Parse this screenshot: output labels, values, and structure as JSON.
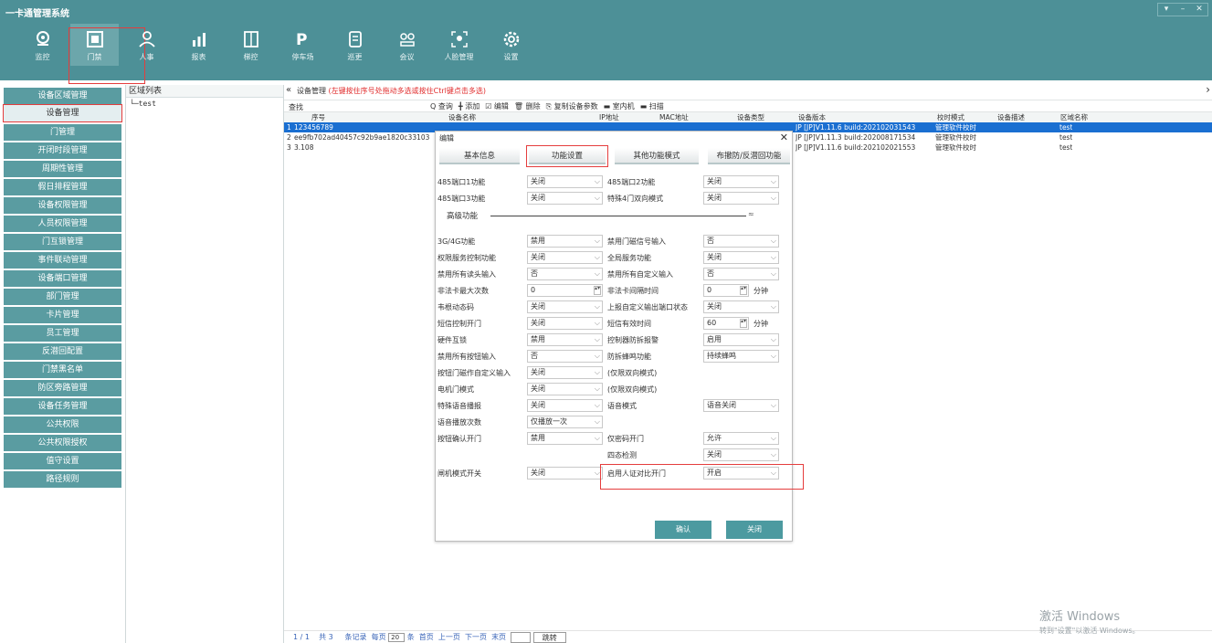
{
  "app": {
    "title": "一卡通管理系统"
  },
  "window_controls": [
    "▾",
    "–",
    "✕"
  ],
  "modules": [
    {
      "label": "监控",
      "icon": "monitor-icon"
    },
    {
      "label": "门禁",
      "icon": "door-access-icon",
      "active": true
    },
    {
      "label": "人事",
      "icon": "person-icon"
    },
    {
      "label": "报表",
      "icon": "report-icon"
    },
    {
      "label": "梯控",
      "icon": "elevator-icon"
    },
    {
      "label": "停车场",
      "icon": "parking-icon"
    },
    {
      "label": "巡更",
      "icon": "patrol-icon"
    },
    {
      "label": "会议",
      "icon": "meeting-icon"
    },
    {
      "label": "人脸管理",
      "icon": "face-icon"
    },
    {
      "label": "设置",
      "icon": "settings-icon"
    }
  ],
  "sidebar": {
    "items": [
      {
        "label": "设备区域管理"
      },
      {
        "label": "设备管理",
        "active": true
      },
      {
        "label": "门管理"
      },
      {
        "label": "开闭时段管理"
      },
      {
        "label": "周期性管理"
      },
      {
        "label": "假日排程管理"
      },
      {
        "label": "设备权限管理"
      },
      {
        "label": "人员权限管理"
      },
      {
        "label": "门互锁管理"
      },
      {
        "label": "事件联动管理"
      },
      {
        "label": "设备端口管理"
      },
      {
        "label": "部门管理"
      },
      {
        "label": "卡片管理"
      },
      {
        "label": "员工管理"
      },
      {
        "label": "反潜回配置"
      },
      {
        "label": "门禁黑名单"
      },
      {
        "label": "防区旁路管理"
      },
      {
        "label": "设备任务管理"
      },
      {
        "label": "公共权限"
      },
      {
        "label": "公共权限授权"
      },
      {
        "label": "值守设置"
      },
      {
        "label": "路径规则"
      }
    ]
  },
  "region": {
    "title": "区域列表",
    "tree_item": "test"
  },
  "main": {
    "collapse_glyph": "«",
    "breadcrumb": "设备管理",
    "hint": "(左键按住序号处拖动多选或按住Ctrl键点击多选)",
    "right_glyph": "›",
    "search_label": "查找",
    "toolbar": [
      "Q 查询",
      "╋ 添加",
      "☑ 编辑",
      "🗑 删除",
      "⎘ 复制设备参数",
      "▬ 室内机",
      "▬ 扫描"
    ]
  },
  "grid": {
    "columns": [
      "序号",
      "设备名称",
      "IP地址",
      "MAC地址",
      "设备类型",
      "设备版本",
      "校时模式",
      "设备描述",
      "区域名称"
    ],
    "rows": [
      {
        "no": "1",
        "serial": "123456789",
        "version": "JP [JP]V1.11.6 build:202102031543",
        "sync": "管理软件校时",
        "region": "test",
        "selected": true
      },
      {
        "no": "2",
        "serial": "ee9fb702ad40457c92b9ae1820c33103",
        "version": "JP [JP]V1.11.3 build:202008171534",
        "sync": "管理软件校时",
        "region": "test"
      },
      {
        "no": "3",
        "serial": "3.108",
        "version": "JP [JP]V1.11.6 build:202102021553",
        "sync": "管理软件校时",
        "region": "test"
      }
    ]
  },
  "dialog": {
    "title": "编辑",
    "close": "✕",
    "tabs": [
      "基本信息",
      "功能设置",
      "其他功能模式",
      "布撤防/反潜回功能"
    ],
    "active_tab": 1,
    "section_title": "高级功能",
    "section_toggle": "≈",
    "fields": {
      "l0": {
        "label": "485端口1功能",
        "value": "关闭"
      },
      "r0": {
        "label": "485端口2功能",
        "value": "关闭"
      },
      "l1": {
        "label": "485端口3功能",
        "value": "关闭"
      },
      "r1": {
        "label": "特殊4门双向模式",
        "value": "关闭"
      },
      "l2": {
        "label": "3G/4G功能",
        "value": "禁用"
      },
      "r2": {
        "label": "禁用门磁信号输入",
        "value": "否"
      },
      "l3": {
        "label": "权限服务控制功能",
        "value": "关闭"
      },
      "r3": {
        "label": "全局服务功能",
        "value": "关闭"
      },
      "l4": {
        "label": "禁用所有读头输入",
        "value": "否"
      },
      "r4": {
        "label": "禁用所有自定义输入",
        "value": "否"
      },
      "l5": {
        "label": "非法卡最大次数",
        "value": "0"
      },
      "r5": {
        "label": "非法卡间隔时间",
        "value": "0",
        "unit": "分钟"
      },
      "l6": {
        "label": "韦根动态码",
        "value": "关闭"
      },
      "r6": {
        "label": "上报自定义输出端口状态",
        "value": "关闭"
      },
      "l7": {
        "label": "短信控制开门",
        "value": "关闭"
      },
      "r7": {
        "label": "短信有效时间",
        "value": "60",
        "unit": "分钟"
      },
      "l8": {
        "label": "硬件互锁",
        "value": "禁用"
      },
      "r8": {
        "label": "控制器防拆报警",
        "value": "启用"
      },
      "l9": {
        "label": "禁用所有按钮输入",
        "value": "否"
      },
      "r9": {
        "label": "防拆蜂鸣功能",
        "value": "持续蜂鸣"
      },
      "l10": {
        "label": "按钮门磁作自定义输入",
        "value": "关闭"
      },
      "r10": {
        "label": "(仅限双向模式)"
      },
      "l11": {
        "label": "电机门模式",
        "value": "关闭"
      },
      "r11": {
        "label": "(仅限双向模式)"
      },
      "l12": {
        "label": "特殊语音播报",
        "value": "关闭"
      },
      "r12": {
        "label": "语音模式",
        "value": "语音关闭"
      },
      "l13": {
        "label": "语音播放次数",
        "value": "仅播放一次"
      },
      "l14": {
        "label": "按钮确认开门",
        "value": "禁用"
      },
      "r14": {
        "label": "仅密码开门",
        "value": "允许"
      },
      "r15": {
        "label": "四态检测",
        "value": "关闭"
      },
      "l16": {
        "label": "闸机模式开关",
        "value": "关闭"
      },
      "r16": {
        "label": "启用人证对比开门",
        "value": "开启"
      }
    },
    "ok": "确认",
    "cancel": "关闭"
  },
  "footer": {
    "pages": "1 / 1",
    "total": "共 3",
    "records": "条记录",
    "per_page_label": "每页",
    "per_page": "20",
    "per_page_unit": "条",
    "first": "首页",
    "prev": "上一页",
    "next": "下一页",
    "last": "末页",
    "jump": "跳转"
  },
  "watermark": {
    "line1": "激活 Windows",
    "line2": "转到\"设置\"以激活 Windows。"
  },
  "colors": {
    "header": "#4d9097",
    "nav": "#5a9ca1",
    "selected_row": "#1a6fd1",
    "highlight": "#e53d3d",
    "button": "#4c9aa0"
  }
}
